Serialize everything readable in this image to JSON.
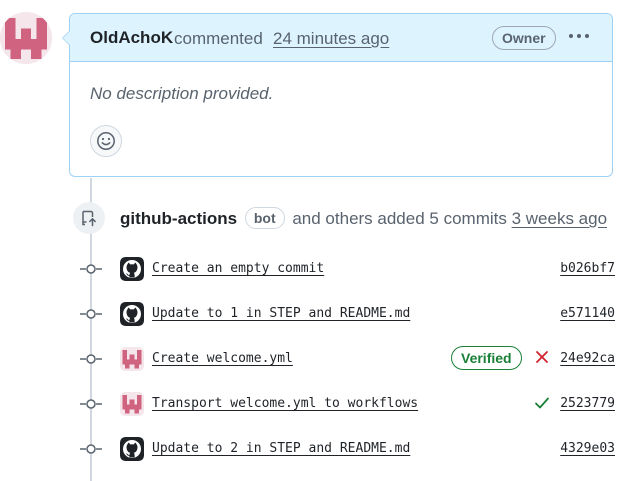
{
  "comment": {
    "author": "OldAchoK",
    "action": "commented",
    "time": "24 minutes ago",
    "role_badge": "Owner",
    "menu_icon": "kebab-horizontal-icon",
    "body": "No description provided.",
    "reaction_icon": "smiley-icon"
  },
  "push_event": {
    "actor": "github-actions",
    "actor_badge": "bot",
    "summary": "and others added 5 commits",
    "time": "3 weeks ago",
    "icon": "repo-push-icon"
  },
  "commits": [
    {
      "message": "Create an empty commit",
      "sha": "b026bf7",
      "avatar": "github-mark-icon"
    },
    {
      "message": "Update to 1 in STEP and README.md",
      "sha": "e571140",
      "avatar": "github-mark-icon"
    },
    {
      "message": "Create welcome.yml",
      "sha": "24e92ca",
      "avatar": "identicon-avatar",
      "badge": "Verified",
      "status": "failure"
    },
    {
      "message": "Transport welcome.yml to workflows",
      "sha": "2523779",
      "avatar": "identicon-avatar",
      "status": "success"
    },
    {
      "message": "Update to 2 in STEP and README.md",
      "sha": "4329e03",
      "avatar": "github-mark-icon"
    }
  ],
  "colors": {
    "header_bg": "#ddf4ff",
    "header_border": "#9fd1f5",
    "identicon": "#d0637f",
    "success": "#1a7f37",
    "failure": "#cf222e",
    "muted_text": "#59636e"
  }
}
